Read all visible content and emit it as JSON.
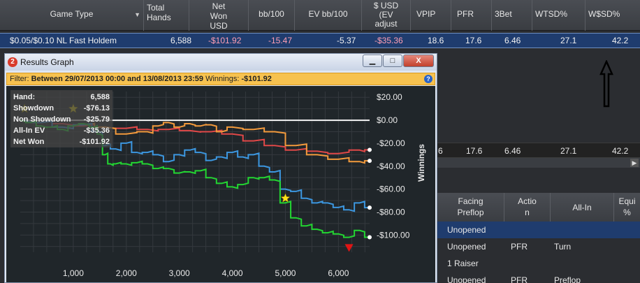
{
  "grid": {
    "headers": {
      "game_type": "Game Type",
      "total_hands": "Total\nHands",
      "net_won": "Net\nWon\nUSD",
      "bb100": "bb/100",
      "ev_bb100": "EV bb/100",
      "usd_ev": "$ USD\n(EV\nadjust",
      "vpip": "VPIP",
      "pfr": "PFR",
      "threebet": "3Bet",
      "wtsd": "WTSD%",
      "wssd": "W$SD%"
    },
    "row": {
      "game_type": "$0.05/$0.10 NL Fast Holdem",
      "total_hands": "6,588",
      "net_won": "-$101.92",
      "bb100": "-15.47",
      "ev_bb100": "-5.37",
      "usd_ev": "-$35.36",
      "vpip": "18.6",
      "pfr": "17.6",
      "threebet": "6.46",
      "wtsd": "27.1",
      "wssd": "42.2"
    },
    "row2": {
      "c0": "6",
      "pfr": "17.6",
      "threebet": "6.46",
      "wtsd": "27.1",
      "wssd": "42.2"
    }
  },
  "hands_table": {
    "headers": {
      "facing": "Facing\nPreflop",
      "action": "Actio\nn",
      "allin": "All-In",
      "equity": "Equi\n%"
    },
    "rows": [
      {
        "facing": "Unopened",
        "action": "",
        "allin": ""
      },
      {
        "facing": "Unopened",
        "action": "PFR",
        "allin": "Turn"
      },
      {
        "facing": "1 Raiser",
        "action": "",
        "allin": ""
      },
      {
        "facing": "Unopened",
        "action": "PFR",
        "allin": "Preflop"
      }
    ]
  },
  "window": {
    "icon_text": "2",
    "title": "Results Graph",
    "buttons": {
      "minimize": "▁",
      "maximize": "□",
      "close": "X"
    },
    "filter_prefix": "Filter:",
    "filter_text": "Between 29/07/2013 00:00 and 13/08/2013 23:59",
    "winnings_label": "Winnings:",
    "winnings_value": "-$101.92",
    "help": "?"
  },
  "graph_stats": [
    {
      "label": "Hand:",
      "value": "6,588"
    },
    {
      "label": "Showdown",
      "value": "-$76.13"
    },
    {
      "label": "Non Showdown",
      "value": "-$25.79"
    },
    {
      "label": "All-In EV",
      "value": "-$35.36"
    },
    {
      "label": "Net Won",
      "value": "-$101.92"
    }
  ],
  "chart_data": {
    "type": "line",
    "xlabel": "",
    "ylabel": "Winnings",
    "xlim": [
      0,
      6588
    ],
    "ylim": [
      -115,
      25
    ],
    "x_ticks": [
      1000,
      2000,
      3000,
      4000,
      5000,
      6000
    ],
    "x_tick_labels": [
      "1,000",
      "2,000",
      "3,000",
      "4,000",
      "5,000",
      "6,000"
    ],
    "y_ticks": [
      20,
      0,
      -20,
      -40,
      -60,
      -80,
      -100
    ],
    "y_tick_labels": [
      "$20.00",
      "$0.00",
      "-$20.00",
      "-$40.00",
      "-$60.00",
      "-$80.00",
      "-$100.00"
    ],
    "series": [
      {
        "color": "#23d632",
        "x": [
          0,
          200,
          400,
          600,
          800,
          1000,
          1200,
          1400,
          1500,
          1600,
          1700,
          1800,
          2000,
          2200,
          2400,
          2600,
          2800,
          3000,
          3200,
          3400,
          3600,
          3800,
          4000,
          4200,
          4400,
          4600,
          4800,
          5000,
          5200,
          5400,
          5600,
          5800,
          6000,
          6200,
          6400,
          6588
        ],
        "y": [
          0,
          -2,
          -5,
          -6,
          -8,
          -5,
          -3,
          -6,
          -12,
          -30,
          -38,
          -38,
          -38,
          -37,
          -38,
          -42,
          -42,
          -46,
          -45,
          -44,
          -50,
          -55,
          -58,
          -56,
          -50,
          -50,
          -52,
          -72,
          -85,
          -92,
          -95,
          -98,
          -99,
          -102,
          -96,
          -101.92
        ]
      },
      {
        "color": "#3c97e0",
        "x": [
          0,
          400,
          800,
          1200,
          1500,
          1600,
          1800,
          2000,
          2200,
          2400,
          2600,
          2800,
          3000,
          3200,
          3400,
          3600,
          3800,
          4000,
          4200,
          4400,
          4600,
          4800,
          5000,
          5200,
          5400,
          5600,
          5800,
          6000,
          6200,
          6400,
          6588
        ],
        "y": [
          0,
          -2,
          -6,
          -4,
          -10,
          -22,
          -25,
          -20,
          -28,
          -28,
          -30,
          -36,
          -30,
          -26,
          -28,
          -35,
          -32,
          -28,
          -32,
          -30,
          -40,
          -45,
          -60,
          -62,
          -68,
          -72,
          -72,
          -76,
          -78,
          -72,
          -76.13
        ]
      },
      {
        "color": "#f39a3c",
        "x": [
          0,
          400,
          800,
          1200,
          1600,
          2000,
          2400,
          2600,
          2800,
          3000,
          3200,
          3400,
          3600,
          3800,
          4000,
          4400,
          4800,
          5200,
          5600,
          6000,
          6400,
          6588
        ],
        "y": [
          0,
          -2,
          -6,
          -4,
          -6,
          -12,
          -10,
          -5,
          -2,
          -6,
          -3,
          -5,
          -4,
          -10,
          -6,
          -8,
          -10,
          -22,
          -30,
          -34,
          -36,
          -35.36
        ]
      },
      {
        "color": "#e04848",
        "x": [
          0,
          400,
          800,
          1200,
          1600,
          2000,
          2400,
          2800,
          3200,
          3600,
          4000,
          4400,
          4800,
          5200,
          5600,
          6000,
          6400,
          6588
        ],
        "y": [
          0,
          -2,
          -3,
          -5,
          -6,
          -7,
          -8,
          -8,
          -9,
          -10,
          -12,
          -18,
          -22,
          -26,
          -27,
          -29,
          -26,
          -25.79
        ]
      }
    ],
    "markers": [
      {
        "kind": "star",
        "color": "#d8c81a",
        "x": 80,
        "y": 10
      },
      {
        "kind": "star",
        "color": "#d8c81a",
        "x": 1000,
        "y": 10
      },
      {
        "kind": "star",
        "color": "#ffe11a",
        "x": 5000,
        "y": -68
      },
      {
        "kind": "triangle-down",
        "color": "#e01414",
        "x": 6200,
        "y": -111
      }
    ]
  },
  "annotation": {
    "arrow": "up-arrow"
  }
}
